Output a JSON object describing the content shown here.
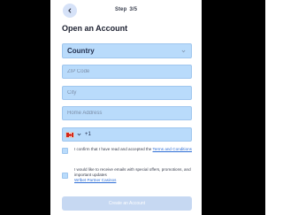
{
  "header": {
    "step_label": "Step",
    "step_value": "3/5"
  },
  "title": "Open an Account",
  "form": {
    "country": {
      "value": "Country"
    },
    "zip": {
      "placeholder": "ZIP Code",
      "value": ""
    },
    "city": {
      "placeholder": "City",
      "value": ""
    },
    "address": {
      "placeholder": "Home Address",
      "value": ""
    },
    "phone": {
      "flag": "canada-flag-icon",
      "dial_code": "+1",
      "value": ""
    }
  },
  "consents": {
    "terms": {
      "text": "I confirm that I have read and accepted the",
      "link": "Terms and Conditions"
    },
    "marketing": {
      "text": "I would like to receive emails with special offers, promotions, and important updates",
      "link": "Wrlbet Partner Casinos"
    }
  },
  "submit": {
    "label": "Create an Account"
  },
  "colors": {
    "field_bg": "#b9dbfb",
    "link": "#2f6fd6",
    "button_disabled": "#c6d8f2"
  }
}
